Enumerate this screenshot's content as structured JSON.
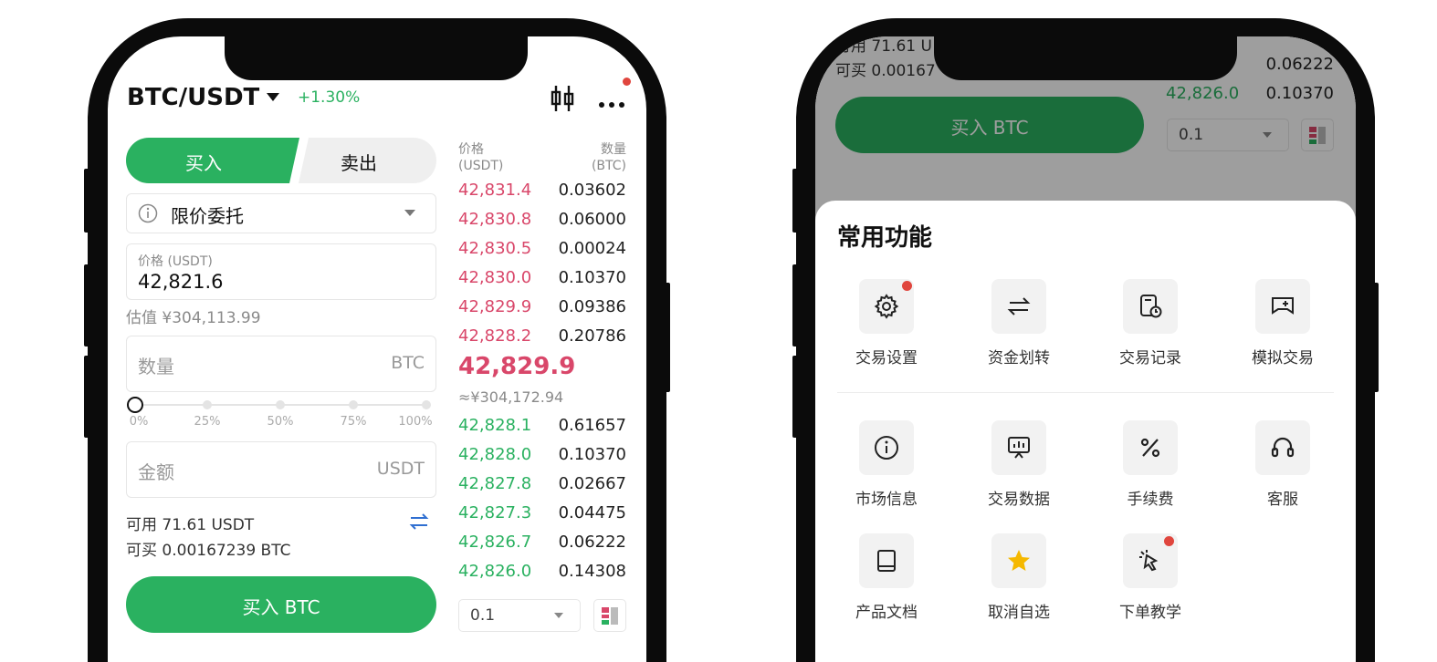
{
  "left": {
    "pair": "BTC/USDT",
    "change": "+1.30%",
    "buy_tab": "买入",
    "sell_tab": "卖出",
    "order_type": "限价委托",
    "price_label": "价格 (USDT)",
    "price_value": "42,821.6",
    "estimate": "估值 ¥304,113.99",
    "qty_placeholder": "数量",
    "qty_unit": "BTC",
    "slider_ticks": [
      "0%",
      "25%",
      "50%",
      "75%",
      "100%"
    ],
    "amount_placeholder": "金额",
    "amount_unit": "USDT",
    "available": "可用 71.61 USDT",
    "can_buy": "可买 0.00167239 BTC",
    "buy_button": "买入 BTC",
    "orderbook": {
      "price_header": "价格",
      "price_unit": "(USDT)",
      "qty_header": "数量",
      "qty_unit": "(BTC)",
      "asks": [
        {
          "price": "42,831.4",
          "qty": "0.03602"
        },
        {
          "price": "42,830.8",
          "qty": "0.06000"
        },
        {
          "price": "42,830.5",
          "qty": "0.00024"
        },
        {
          "price": "42,830.0",
          "qty": "0.10370"
        },
        {
          "price": "42,829.9",
          "qty": "0.09386"
        },
        {
          "price": "42,828.2",
          "qty": "0.20786"
        }
      ],
      "last_price": "42,829.9",
      "last_cny": "≈¥304,172.94",
      "bids": [
        {
          "price": "42,828.1",
          "qty": "0.61657"
        },
        {
          "price": "42,828.0",
          "qty": "0.10370"
        },
        {
          "price": "42,827.8",
          "qty": "0.02667"
        },
        {
          "price": "42,827.3",
          "qty": "0.04475"
        },
        {
          "price": "42,826.7",
          "qty": "0.06222"
        },
        {
          "price": "42,826.0",
          "qty": "0.14308"
        }
      ],
      "depth_select": "0.1"
    }
  },
  "right": {
    "top_available": "可用 71.61 U",
    "top_can_buy": "可买 0.00167",
    "top_qty_1": "0.06222",
    "top_price_2": "42,826.0",
    "top_qty_2": "0.10370",
    "buy_button": "买入 BTC",
    "depth_select": "0.1",
    "sheet_title": "常用功能",
    "items": [
      {
        "label": "交易设置",
        "icon": "gear-icon",
        "badge": true
      },
      {
        "label": "资金划转",
        "icon": "transfer-icon",
        "badge": false
      },
      {
        "label": "交易记录",
        "icon": "record-icon",
        "badge": false
      },
      {
        "label": "模拟交易",
        "icon": "gamepad-icon",
        "badge": false
      },
      {
        "label": "市场信息",
        "icon": "info-icon",
        "badge": false
      },
      {
        "label": "交易数据",
        "icon": "data-icon",
        "badge": false
      },
      {
        "label": "手续费",
        "icon": "percent-icon",
        "badge": false
      },
      {
        "label": "客服",
        "icon": "headset-icon",
        "badge": false
      },
      {
        "label": "产品文档",
        "icon": "book-icon",
        "badge": false
      },
      {
        "label": "取消自选",
        "icon": "star-icon",
        "badge": false
      },
      {
        "label": "下单教学",
        "icon": "tutorial-icon",
        "badge": true
      }
    ]
  },
  "colors": {
    "buy_green": "#2ab160",
    "ask_red": "#d9476a",
    "star_yellow": "#f5b800",
    "badge_red": "#e0463e"
  }
}
